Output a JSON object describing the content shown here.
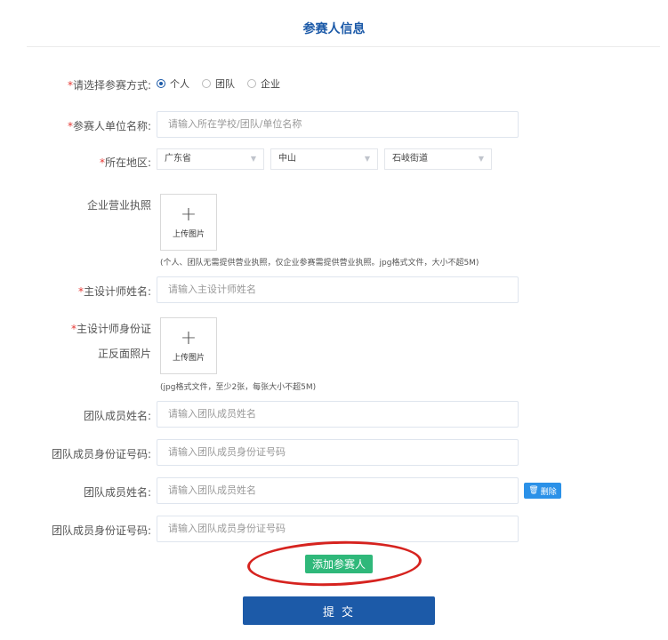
{
  "page": {
    "title": "参赛人信息"
  },
  "entry_mode": {
    "label": "请选择参赛方式:",
    "options": [
      "个人",
      "团队",
      "企业"
    ],
    "selected": "个人"
  },
  "unit_name": {
    "label": "参赛人单位名称:",
    "placeholder": "请输入所在学校/团队/单位名称"
  },
  "region": {
    "label": "所在地区:",
    "province": "广东省",
    "city": "中山",
    "street": "石岐街道"
  },
  "license": {
    "label": "企业营业执照",
    "upload_label": "上传图片",
    "hint": "(个人、团队无需提供营业执照，仅企业参赛需提供营业执照。jpg格式文件，大小不超5M)"
  },
  "designer_name": {
    "label": "主设计师姓名:",
    "placeholder": "请输入主设计师姓名"
  },
  "designer_id_photo": {
    "label_line1": "主设计师身份证",
    "label_line2": "正反面照片",
    "upload_label": "上传图片",
    "hint": "(jpg格式文件，至少2张，每张大小不超5M)"
  },
  "members": [
    {
      "name_label": "团队成员姓名:",
      "name_placeholder": "请输入团队成员姓名",
      "id_label": "团队成员身份证号码:",
      "id_placeholder": "请输入团队成员身份证号码"
    },
    {
      "name_label": "团队成员姓名:",
      "name_placeholder": "请输入团队成员姓名",
      "id_label": "团队成员身份证号码:",
      "id_placeholder": "请输入团队成员身份证号码"
    }
  ],
  "delete_label": "删除",
  "add_participant_label": "添加参赛人",
  "submit_label": "提 交",
  "colors": {
    "primary": "#1c5aa8",
    "required": "#e53935",
    "add_button": "#2fb87a",
    "delete_button": "#2b91e8",
    "annotation_oval": "#d6231f"
  }
}
